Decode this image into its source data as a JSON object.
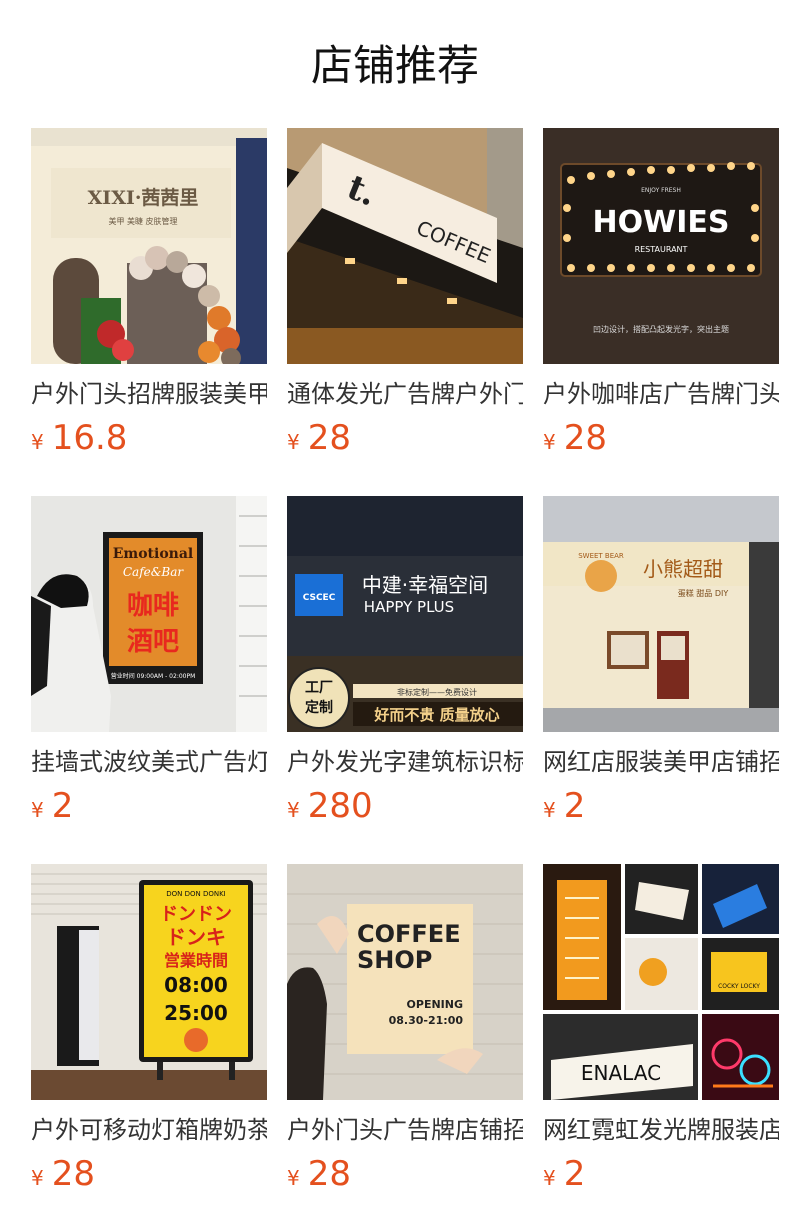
{
  "header": {
    "title": "店铺推荐"
  },
  "products": [
    {
      "name": "户外门头招牌服装美甲店铺",
      "currency": "¥",
      "price": "16.8",
      "image_text": {
        "main": "XIXI·茜茜里",
        "sub": "美甲 美睫 皮肤管理"
      }
    },
    {
      "name": "通体发光广告牌户外门头灯箱",
      "currency": "¥",
      "price": "28",
      "image_text": {
        "main": "t.",
        "sub": "COFFEE"
      }
    },
    {
      "name": "户外咖啡店广告牌门头招牌",
      "currency": "¥",
      "price": "28",
      "image_text": {
        "top": "ENJOY FRESH",
        "main": "HOWIES",
        "sub": "RESTAURANT",
        "note": "凹边设计，搭配凸起发光字，突出主题"
      }
    },
    {
      "name": "挂墙式波纹美式广告灯箱",
      "currency": "¥",
      "price": "2",
      "image_text": {
        "top": "Emotional",
        "script": "Cafe&Bar",
        "l1": "咖啡",
        "l2": "酒吧",
        "hours": "营业时间 09:00AM - 02:00PM"
      }
    },
    {
      "name": "户外发光字建筑标识标牌",
      "currency": "¥",
      "price": "280",
      "image_text": {
        "logo": "CSCEC",
        "main": "中建·幸福空间",
        "sub": "HAPPY PLUS",
        "badge_l1": "工厂",
        "badge_l2": "定制",
        "tag1": "非标定制——免费设计",
        "tag2": "好而不贵 质量放心"
      }
    },
    {
      "name": "网红店服装美甲店铺招牌",
      "currency": "¥",
      "price": "2",
      "image_text": {
        "arc": "SWEET BEAR",
        "main": "小熊超甜",
        "sub": "蛋糕 甜品 DIY"
      }
    },
    {
      "name": "户外可移动灯箱牌奶茶店",
      "currency": "¥",
      "price": "28",
      "image_text": {
        "top": "DON DON DONKI",
        "l1": "ドンドン",
        "l2": "ドンキ",
        "l3": "営業時間",
        "l4": "08:00",
        "l5": "25:00"
      }
    },
    {
      "name": "户外门头广告牌店铺招牌",
      "currency": "¥",
      "price": "28",
      "image_text": {
        "l1": "COFFEE",
        "l2": "SHOP",
        "open": "OPENING",
        "hours": "08.30-21:00"
      }
    },
    {
      "name": "网红霓虹发光牌服装店铺",
      "currency": "¥",
      "price": "2",
      "image_text": {
        "sign": "ENALAC",
        "small": "COCKY LOCKY"
      }
    }
  ]
}
